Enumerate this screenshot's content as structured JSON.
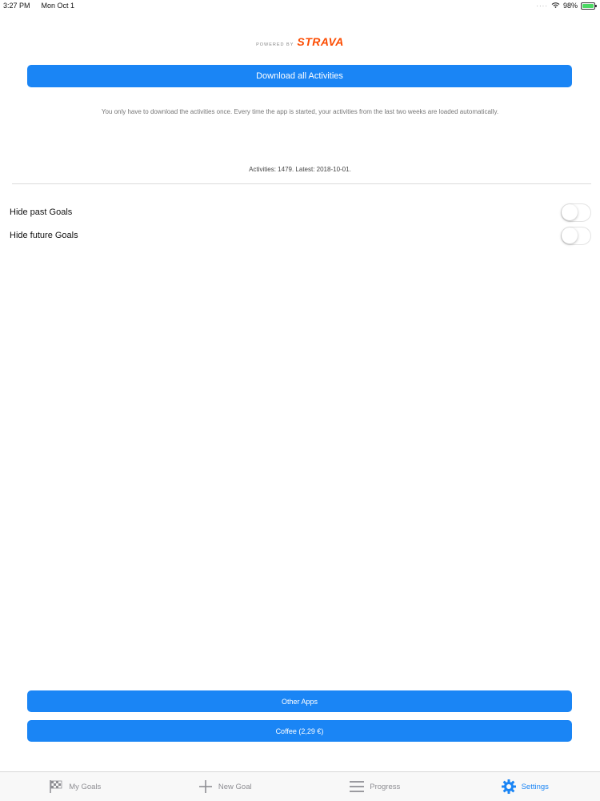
{
  "status_bar": {
    "time": "3:27 PM",
    "date": "Mon Oct 1",
    "battery": "98%"
  },
  "branding": {
    "powered_by": "POWERED BY",
    "logo_text": "STRAVA",
    "logo_color": "#fc4c02"
  },
  "download": {
    "button_label": "Download all Activities",
    "info": "You only have to download the activities once. Every time the app is started, your activities from the last two weeks are loaded automatically.",
    "summary": "Activities: 1479. Latest: 2018-10-01."
  },
  "settings": {
    "hide_past_label": "Hide past Goals",
    "hide_past_on": false,
    "hide_future_label": "Hide future Goals",
    "hide_future_on": false
  },
  "footer_buttons": {
    "other_apps": "Other Apps",
    "coffee": "Coffee (2,29 €)"
  },
  "tabs": [
    {
      "label": "My Goals",
      "icon": "checkered-flag-icon",
      "active": false
    },
    {
      "label": "New Goal",
      "icon": "plus-icon",
      "active": false
    },
    {
      "label": "Progress",
      "icon": "list-lines-icon",
      "active": false
    },
    {
      "label": "Settings",
      "icon": "gear-icon",
      "active": true
    }
  ],
  "colors": {
    "accent": "#1a85f5",
    "tab_inactive": "#8e8e93"
  }
}
